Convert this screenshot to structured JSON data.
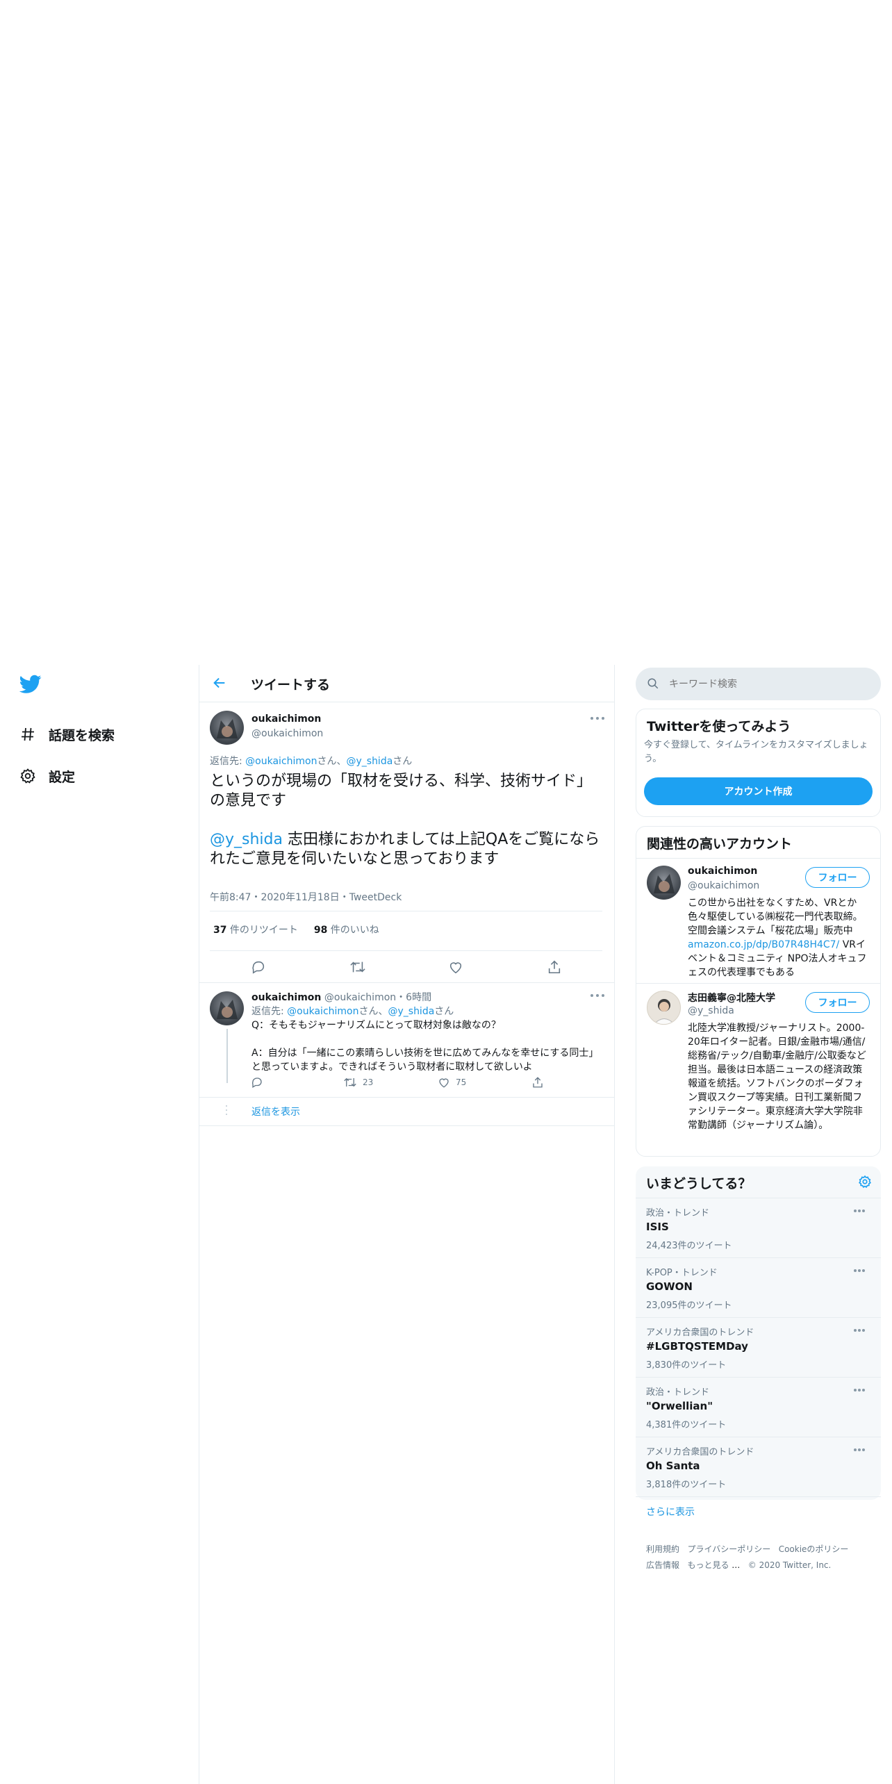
{
  "nav": {
    "explore_label": "話題を検索",
    "settings_label": "設定"
  },
  "header": {
    "title": "ツイートする"
  },
  "main_tweet": {
    "display_name": "oukaichimon",
    "handle": "@oukaichimon",
    "reply_prefix": "返信先: ",
    "reply_to_1": "@oukaichimon",
    "reply_sep": "さん、",
    "reply_to_2": "@y_shida",
    "reply_suffix": "さん",
    "text_line1": "というのが現場の「取材を受ける、科学、技術サイド」の意見です",
    "mention": "@y_shida",
    "text_line2": " 志田様におかれましては上記QAをご覧になられたご意見を伺いたいなと思っております",
    "timestamp": "午前8:47・2020年11月18日・",
    "source": "TweetDeck",
    "retweet_count": "37",
    "retweet_label": " 件のリツイート",
    "like_count": "98",
    "like_label": " 件のいいね"
  },
  "reply_tweet": {
    "display_name": "oukaichimon",
    "handle": "@oukaichimon",
    "time": "・6時間",
    "reply_prefix": "返信先: ",
    "reply_to_1": "@oukaichimon",
    "reply_sep": "さん、",
    "reply_to_2": "@y_shida",
    "reply_suffix": "さん",
    "text_q": "Q：そもそもジャーナリズムにとって取材対象は敵なの？",
    "text_a": "A：自分は「一緒にこの素晴らしい技術を世に広めてみんなを幸せにする同士」と思っていますよ。できればそういう取材者に取材して欲しいよ",
    "retweets": "23",
    "likes": "75",
    "show_replies": "返信を表示"
  },
  "search": {
    "placeholder": "キーワード検索"
  },
  "signup_card": {
    "title": "Twitterを使ってみよう",
    "subtitle": "今すぐ登録して、タイムラインをカスタマイズしましょう。",
    "button": "アカウント作成"
  },
  "relevant": {
    "title": "関連性の高いアカウント",
    "follow_label": "フォロー",
    "accounts": [
      {
        "name": "oukaichimon",
        "handle": "@oukaichimon",
        "bio_before": "この世から出社をなくすため、VRとか色々駆使している㈱桜花一門代表取締。空間会議システム「桜花広場」販売中 ",
        "bio_link": "amazon.co.jp/dp/B07R48H4C7/",
        "bio_after": " VRイベント＆コミュニティ NPO法人オキュフェスの代表理事でもある"
      },
      {
        "name": "志田義寧@北陸大学",
        "handle": "@y_shida",
        "bio_before": "北陸大学准教授/ジャーナリスト。2000-20年ロイター記者。日銀/金融市場/通信/総務省/テック/自動車/金融庁/公取委など担当。最後は日本語ニュースの経済政策報道を統括。ソフトバンクのボーダフォン買収スクープ等実績。日刊工業新聞ファシリテーター。東京経済大学大学院非常勤講師（ジャーナリズム論）。",
        "bio_link": "",
        "bio_after": ""
      }
    ]
  },
  "trends": {
    "title": "いまどうしてる？",
    "items": [
      {
        "context": "政治・トレンド",
        "name": "ISIS",
        "count": "24,423件のツイート"
      },
      {
        "context": "K-POP・トレンド",
        "name": "GOWON",
        "count": "23,095件のツイート"
      },
      {
        "context": "アメリカ合衆国のトレンド",
        "name": "#LGBTQSTEMDay",
        "count": "3,830件のツイート"
      },
      {
        "context": "政治・トレンド",
        "name": "\"Orwellian\"",
        "count": "4,381件のツイート"
      },
      {
        "context": "アメリカ合衆国のトレンド",
        "name": "Oh Santa",
        "count": "3,818件のツイート"
      }
    ],
    "show_more": "さらに表示"
  },
  "footer": {
    "terms": "利用規約",
    "privacy": "プライバシーポリシー",
    "cookie": "Cookieのポリシー",
    "ads": "広告情報",
    "more": "もっと見る",
    "copyright": "© 2020 Twitter, Inc."
  },
  "colors": {
    "brand": "#1da1f2",
    "link": "#1b95e0",
    "muted": "#657786",
    "border": "#e6ecf0",
    "trend_bg": "#f5f8fa"
  },
  "icons": [
    "twitter-logo-icon",
    "hashtag-icon",
    "gear-icon",
    "back-arrow-icon",
    "more-icon",
    "reply-icon",
    "retweet-icon",
    "like-icon",
    "share-icon",
    "search-icon",
    "settings-icon"
  ]
}
